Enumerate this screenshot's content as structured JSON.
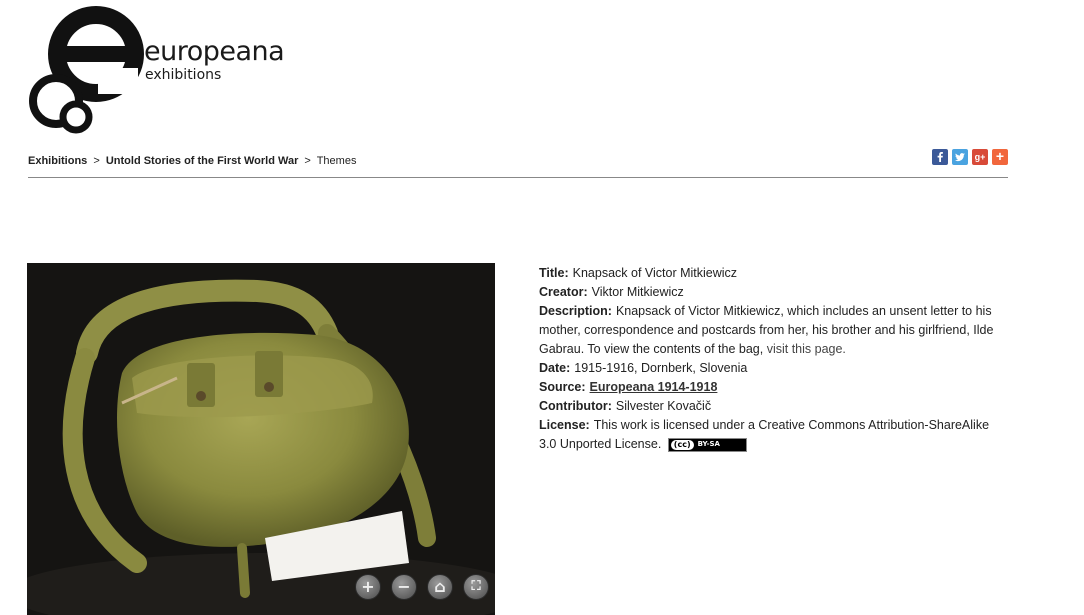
{
  "logo": {
    "word": "europeana",
    "sub": "exhibitions"
  },
  "breadcrumb": {
    "items": [
      "Exhibitions",
      "Untold Stories of the First World War"
    ],
    "separator": ">",
    "current": "Themes"
  },
  "share": {
    "icons": [
      "facebook-icon",
      "twitter-icon",
      "google-plus-icon",
      "add-share-icon"
    ]
  },
  "viewer": {
    "controls": {
      "zoom_in": "+",
      "zoom_out": "−",
      "home": "⌂",
      "fullscreen": "⛶"
    }
  },
  "meta": {
    "title_label": "Title:",
    "title": "Knapsack of Victor Mitkiewicz",
    "creator_label": "Creator:",
    "creator": "Viktor Mitkiewicz",
    "description_label": "Description:",
    "description": "Knapsack of Victor Mitkiewicz, which includes an unsent letter to his mother, correspondence and postcards from her, his brother and his girlfriend, Ilde Gabrau. To view the contents of the bag,",
    "description_link": "visit this page.",
    "date_label": "Date:",
    "date": "1915-1916, Dornberk, Slovenia",
    "source_label": "Source:",
    "source": "Europeana 1914-1918",
    "contributor_label": "Contributor:",
    "contributor": "Silvester Kovačič",
    "license_label": "License:",
    "license": "This work is licensed under a Creative Commons Attribution-ShareAlike 3.0 Unported License.",
    "cc_left": "(cc)",
    "cc_right": "BY-SA"
  }
}
